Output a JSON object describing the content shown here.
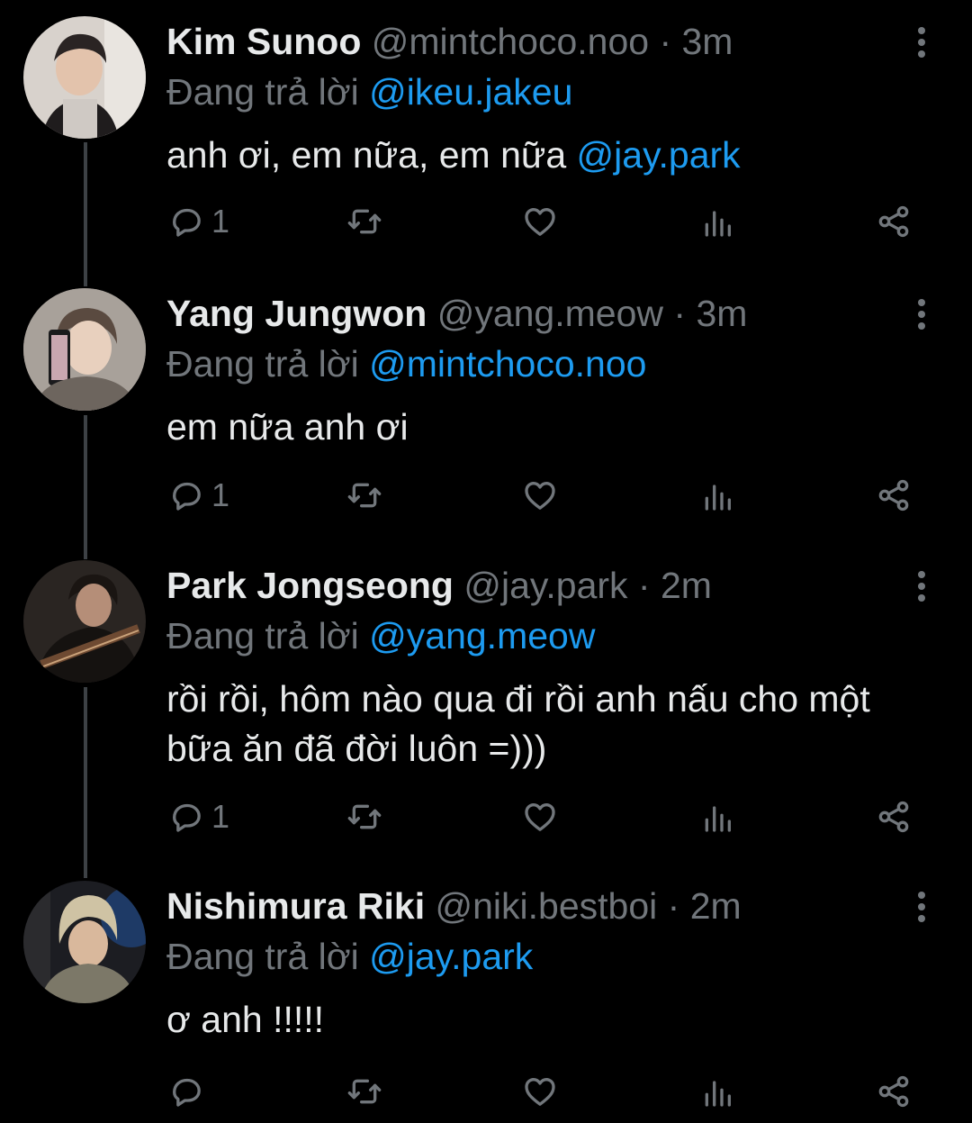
{
  "reply_prefix": "Đang trả lời",
  "tweets": [
    {
      "name": "Kim Sunoo",
      "handle": "@mintchoco.noo",
      "time": "3m",
      "replying_to": "@ikeu.jakeu",
      "text": "anh ơi, em nữa, em nữa ",
      "text_mention": "@jay.park",
      "reply_count": "1"
    },
    {
      "name": "Yang Jungwon",
      "handle": "@yang.meow",
      "time": "3m",
      "replying_to": "@mintchoco.noo",
      "text": "em nữa anh ơi",
      "text_mention": "",
      "reply_count": "1"
    },
    {
      "name": "Park Jongseong",
      "handle": "@jay.park",
      "time": "2m",
      "replying_to": "@yang.meow",
      "text": "rồi rồi, hôm nào qua đi rồi anh nấu cho một bữa ăn đã đời luôn =)))",
      "text_mention": "",
      "reply_count": "1"
    },
    {
      "name": "Nishimura Riki",
      "handle": "@niki.bestboi",
      "time": "2m",
      "replying_to": "@jay.park",
      "text": "ơ anh !!!!!",
      "text_mention": "",
      "reply_count": ""
    }
  ],
  "separator": " · ",
  "colors": {
    "background": "#000000",
    "text": "#e7e9ea",
    "muted": "#71767b",
    "accent": "#1d9bf0",
    "thread_line": "#3d4145"
  },
  "icons": [
    "reply-icon",
    "retweet-icon",
    "like-icon",
    "views-icon",
    "share-icon",
    "more-icon"
  ]
}
